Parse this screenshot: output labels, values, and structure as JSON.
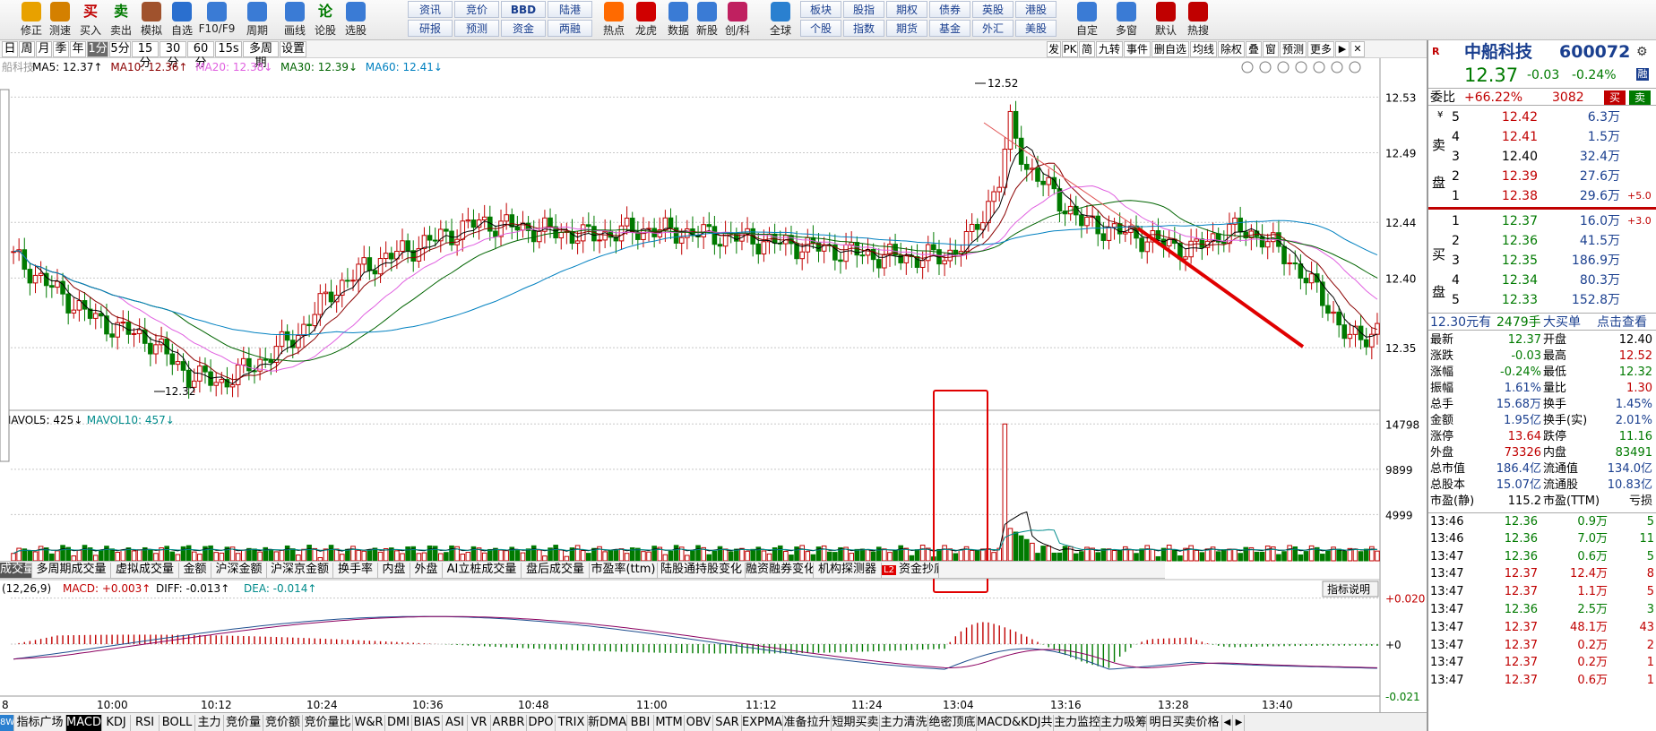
{
  "toolbar": {
    "buttons": [
      {
        "label": "修正",
        "icon": "up-arrow-icon",
        "color": "#e8a100"
      },
      {
        "label": "测速",
        "icon": "speed-icon",
        "color": "#d48000"
      },
      {
        "label": "买入",
        "icon": "buy-icon",
        "color": "#ffffff",
        "glyph": "买"
      },
      {
        "label": "卖出",
        "icon": "sell-icon",
        "color": "#ffffff",
        "glyph": "卖"
      },
      {
        "label": "模拟",
        "icon": "hammer-icon",
        "color": "#a0522d"
      },
      {
        "label": "自选",
        "icon": "star-icon",
        "color": "#2a6fcf"
      },
      {
        "label": "F10/F9",
        "icon": "window-icon",
        "color": "#3a7bd5"
      },
      {
        "label": "周期",
        "icon": "clock-icon",
        "color": "#3a7bd5"
      },
      {
        "label": "画线",
        "icon": "pen-icon",
        "color": "#3a7bd5"
      },
      {
        "label": "论股",
        "icon": "forum-icon",
        "color": "#1a3f8f",
        "glyph": "论"
      },
      {
        "label": "选股",
        "icon": "magnifier-icon",
        "color": "#3a7bd5"
      }
    ],
    "grid": [
      [
        "资讯",
        "竞价",
        "BBD",
        "陆港"
      ],
      [
        "研报",
        "预测",
        "资金",
        "两融"
      ]
    ],
    "mid_buttons": [
      {
        "label": "热点",
        "icon": "hot-icon"
      },
      {
        "label": "龙虎",
        "icon": "dragon-icon"
      },
      {
        "label": "数据",
        "icon": "data-icon"
      },
      {
        "label": "新股",
        "icon": "newstock-icon"
      },
      {
        "label": "创/科",
        "icon": "star-market-icon"
      },
      {
        "label": "全球",
        "icon": "globe-icon"
      }
    ],
    "grid2": [
      [
        "板块",
        "股指",
        "期权",
        "债券",
        "英股",
        "港股"
      ],
      [
        "个股",
        "指数",
        "期货",
        "基金",
        "外汇",
        "美股"
      ]
    ],
    "right_buttons": [
      {
        "label": "自定",
        "icon": "custom-icon"
      },
      {
        "label": "多窗",
        "icon": "multiwindow-icon"
      },
      {
        "label": "默认",
        "icon": "home-icon"
      },
      {
        "label": "热搜",
        "icon": "hotsearch-icon"
      }
    ]
  },
  "period_bar": {
    "items": [
      "日",
      "周",
      "月",
      "季",
      "年",
      "1分",
      "5分",
      "15分",
      "30分",
      "60分",
      "15s",
      "多周期",
      "设置"
    ],
    "active": "1分",
    "right_items": [
      "发",
      "PK",
      "简",
      "九转",
      "事件",
      "删自选",
      "均线",
      "除权",
      "叠",
      "窗",
      "预测",
      "更多"
    ]
  },
  "price_chart": {
    "stock_label": "船科技",
    "ma": [
      {
        "name": "MA5",
        "value": "12.37",
        "color": "#000000",
        "arrow": "↑"
      },
      {
        "name": "MA10",
        "value": "12.36",
        "color": "#8b0000",
        "arrow": "↑"
      },
      {
        "name": "MA20",
        "value": "12.38",
        "color": "#e060e0",
        "arrow": "↓"
      },
      {
        "name": "MA30",
        "value": "12.39",
        "color": "#006400",
        "arrow": "↓"
      },
      {
        "name": "MA60",
        "value": "12.41",
        "color": "#0080c0",
        "arrow": "↓"
      }
    ],
    "y_ticks": [
      "12.53",
      "12.49",
      "12.44",
      "12.40",
      "12.35"
    ],
    "high_label": "12.52",
    "low_label": "12.32"
  },
  "volume_chart": {
    "legend": [
      {
        "name": "MAVOL5",
        "value": "425",
        "arrow": "↓",
        "color": "#000000"
      },
      {
        "name": "MAVOL10",
        "value": "457",
        "arrow": "↓",
        "color": "#008b8b"
      }
    ],
    "y_ticks": [
      "14798",
      "9899",
      "4999"
    ]
  },
  "volume_tabs": {
    "items": [
      "成交量",
      "多周期成交量",
      "虚拟成交量",
      "金额",
      "沪深金额",
      "沪深京金额",
      "换手率",
      "内盘",
      "外盘",
      "AI立桩成交量",
      "盘后成交量",
      "市盈率(ttm)",
      "陆股通持股变化",
      "融资融券变化",
      "机构探测器",
      "资金抄底"
    ],
    "active": "成交量",
    "l2_badge": "L2"
  },
  "macd_chart": {
    "params": "(12,26,9)",
    "macd": "+0.003",
    "diff": "-0.013",
    "dea": "-0.014",
    "y_ticks": [
      "+0.020",
      "+0",
      "-0.021"
    ],
    "help_button": "指标说明"
  },
  "x_axis": [
    "8",
    "10:00",
    "10:12",
    "10:24",
    "10:36",
    "10:48",
    "11:00",
    "11:12",
    "11:24",
    "13:04",
    "13:16",
    "13:28",
    "13:40"
  ],
  "indicator_tabs": {
    "items": [
      "8W",
      "指标广场",
      "MACD",
      "KDJ",
      "RSI",
      "BOLL",
      "主力",
      "竞价量",
      "竞价额",
      "竞价量比",
      "W&R",
      "DMI",
      "BIAS",
      "ASI",
      "VR",
      "ARBR",
      "DPO",
      "TRIX",
      "新DMA",
      "BBI",
      "MTM",
      "OBV",
      "SAR",
      "EXPMA",
      "准备拉升",
      "短期买卖",
      "主力清洗",
      "绝密顶底",
      "MACD&KDJ共振",
      "主力监控",
      "主力吸筹",
      "明日买卖价格"
    ],
    "active": "MACD"
  },
  "quote": {
    "name": "中船科技",
    "code": "600072",
    "price": "12.37",
    "change": "-0.03",
    "change_pct": "-0.24%",
    "exchange_badge": "融",
    "weibi_label": "委比",
    "weibi": "+66.22%",
    "weicha": "3082",
    "buy_label": "买",
    "sell_label": "卖",
    "sell_side_label": [
      "卖",
      "盘"
    ],
    "buy_side_label": [
      "买",
      "盘"
    ],
    "asks": [
      {
        "level": "5",
        "price": "12.42",
        "vol": "6.3万"
      },
      {
        "level": "4",
        "price": "12.41",
        "vol": "1.5万"
      },
      {
        "level": "3",
        "price": "12.40",
        "vol": "32.4万"
      },
      {
        "level": "2",
        "price": "12.39",
        "vol": "27.6万"
      },
      {
        "level": "1",
        "price": "12.38",
        "vol": "29.6万",
        "extra": "+5.0"
      }
    ],
    "bids": [
      {
        "level": "1",
        "price": "12.37",
        "vol": "16.0万",
        "extra": "+3.0"
      },
      {
        "level": "2",
        "price": "12.36",
        "vol": "41.5万"
      },
      {
        "level": "3",
        "price": "12.35",
        "vol": "186.9万"
      },
      {
        "level": "4",
        "price": "12.34",
        "vol": "80.3万"
      },
      {
        "level": "5",
        "price": "12.33",
        "vol": "152.8万"
      }
    ],
    "big_order": {
      "price_text": "12.30元有",
      "vol_text": "2479手",
      "kind": "大买单",
      "link": "点击查看"
    },
    "stats": [
      {
        "l1": "最新",
        "v1": "12.37",
        "c1": "green",
        "l2": "开盘",
        "v2": "12.40",
        "c2": "black"
      },
      {
        "l1": "涨跌",
        "v1": "-0.03",
        "c1": "green",
        "l2": "最高",
        "v2": "12.52",
        "c2": "red"
      },
      {
        "l1": "涨幅",
        "v1": "-0.24%",
        "c1": "green",
        "l2": "最低",
        "v2": "12.32",
        "c2": "green"
      },
      {
        "l1": "振幅",
        "v1": "1.61%",
        "c1": "blue",
        "l2": "量比",
        "v2": "1.30",
        "c2": "red"
      },
      {
        "l1": "总手",
        "v1": "15.68万",
        "c1": "blue",
        "l2": "换手",
        "v2": "1.45%",
        "c2": "blue"
      },
      {
        "l1": "金额",
        "v1": "1.95亿",
        "c1": "blue",
        "l2": "换手(实)",
        "v2": "2.01%",
        "c2": "blue"
      },
      {
        "l1": "涨停",
        "v1": "13.64",
        "c1": "red",
        "l2": "跌停",
        "v2": "11.16",
        "c2": "green"
      },
      {
        "l1": "外盘",
        "v1": "73326",
        "c1": "red",
        "l2": "内盘",
        "v2": "83491",
        "c2": "green"
      },
      {
        "l1": "总市值",
        "v1": "186.4亿",
        "c1": "blue",
        "l2": "流通值",
        "v2": "134.0亿",
        "c2": "blue"
      },
      {
        "l1": "总股本",
        "v1": "15.07亿",
        "c1": "blue",
        "l2": "流通股",
        "v2": "10.83亿",
        "c2": "blue"
      },
      {
        "l1": "市盈(静)",
        "v1": "115.2",
        "c1": "black",
        "l2": "市盈(TTM)",
        "v2": "亏损",
        "c2": "black"
      }
    ],
    "ticks": [
      {
        "time": "13:46",
        "price": "12.36",
        "vol": "0.9万",
        "n": "5",
        "c": "green"
      },
      {
        "time": "13:46",
        "price": "12.36",
        "vol": "7.0万",
        "n": "11",
        "c": "green"
      },
      {
        "time": "13:47",
        "price": "12.36",
        "vol": "0.6万",
        "n": "5",
        "c": "green"
      },
      {
        "time": "13:47",
        "price": "12.37",
        "vol": "12.4万",
        "n": "8",
        "c": "red"
      },
      {
        "time": "13:47",
        "price": "12.37",
        "vol": "1.1万",
        "n": "5",
        "c": "red"
      },
      {
        "time": "13:47",
        "price": "12.36",
        "vol": "2.5万",
        "n": "3",
        "c": "green"
      },
      {
        "time": "13:47",
        "price": "12.37",
        "vol": "48.1万",
        "n": "43",
        "c": "red"
      },
      {
        "time": "13:47",
        "price": "12.37",
        "vol": "0.2万",
        "n": "2",
        "c": "red"
      },
      {
        "time": "13:47",
        "price": "12.37",
        "vol": "0.2万",
        "n": "1",
        "c": "red"
      },
      {
        "time": "13:47",
        "price": "12.37",
        "vol": "0.6万",
        "n": "1",
        "c": "red"
      }
    ]
  },
  "colors": {
    "up": "#c00000",
    "down": "#007a00",
    "accent": "#1a3f8f"
  }
}
